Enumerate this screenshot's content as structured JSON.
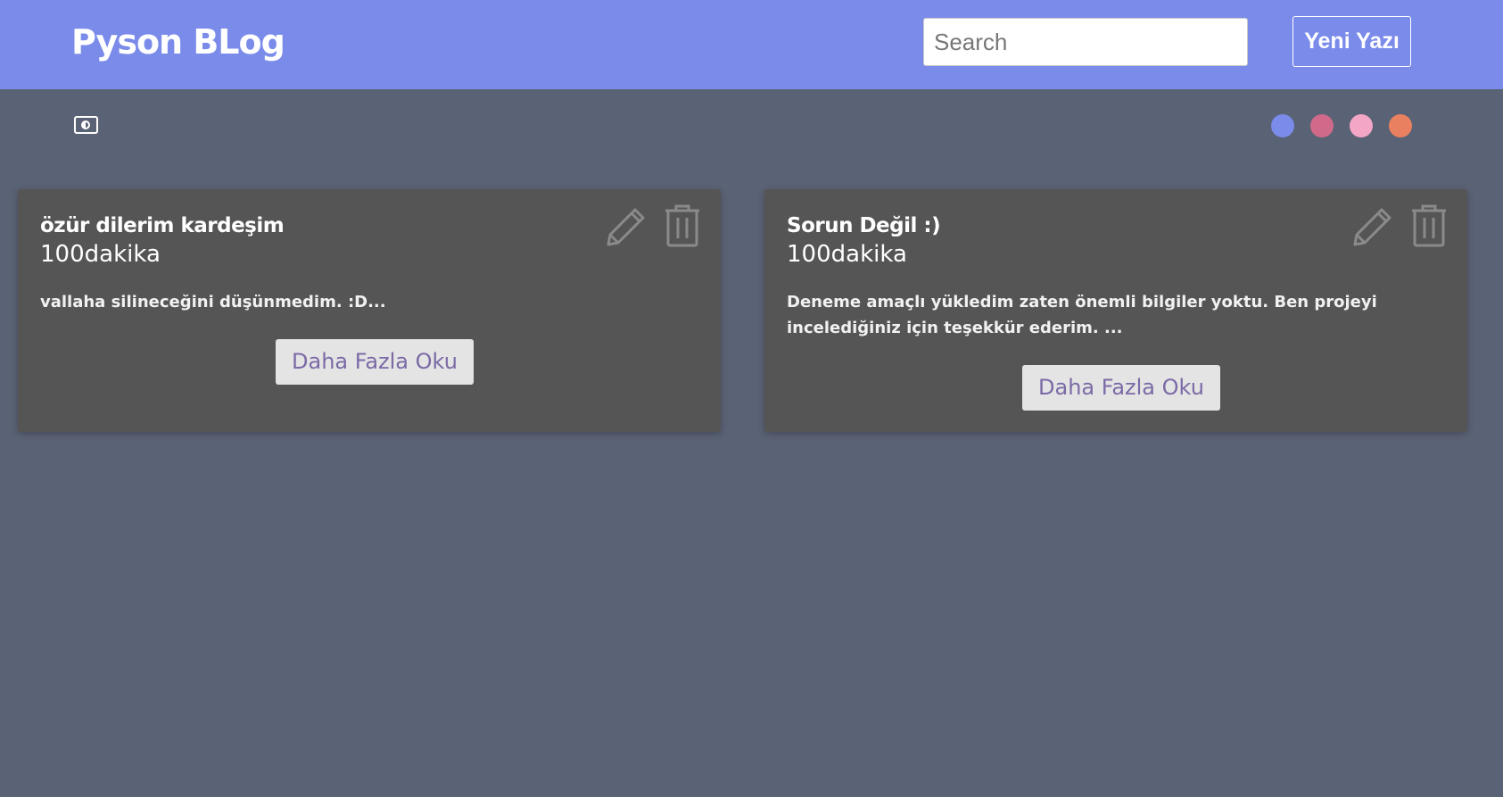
{
  "header": {
    "brand": "Pyson BLog",
    "search_placeholder": "Search",
    "new_post_label": "Yeni Yazı"
  },
  "toolbar": {
    "contrast_icon": "contrast-icon",
    "theme_colors": [
      "#7a8bea",
      "#d16a8a",
      "#f3a6c6",
      "#e9805f"
    ]
  },
  "posts": [
    {
      "title": "özür dilerim kardeşim",
      "read_time": "100dakika",
      "excerpt": "vallaha silineceğini düşünmedim. :D...",
      "read_more_label": "Daha Fazla Oku",
      "edit_icon": "pencil-icon",
      "delete_icon": "trash-icon"
    },
    {
      "title": "Sorun Değil :)",
      "read_time": "100dakika",
      "excerpt": "Deneme amaçlı yükledim zaten önemli bilgiler yoktu. Ben projeyi incelediğiniz için teşekkür ederim. ...",
      "read_more_label": "Daha Fazla Oku",
      "edit_icon": "pencil-icon",
      "delete_icon": "trash-icon"
    }
  ],
  "colors": {
    "navbar": "#7a8bea",
    "background": "#5a6275",
    "card": "#555555",
    "read_more_text": "#7b6aa6"
  }
}
